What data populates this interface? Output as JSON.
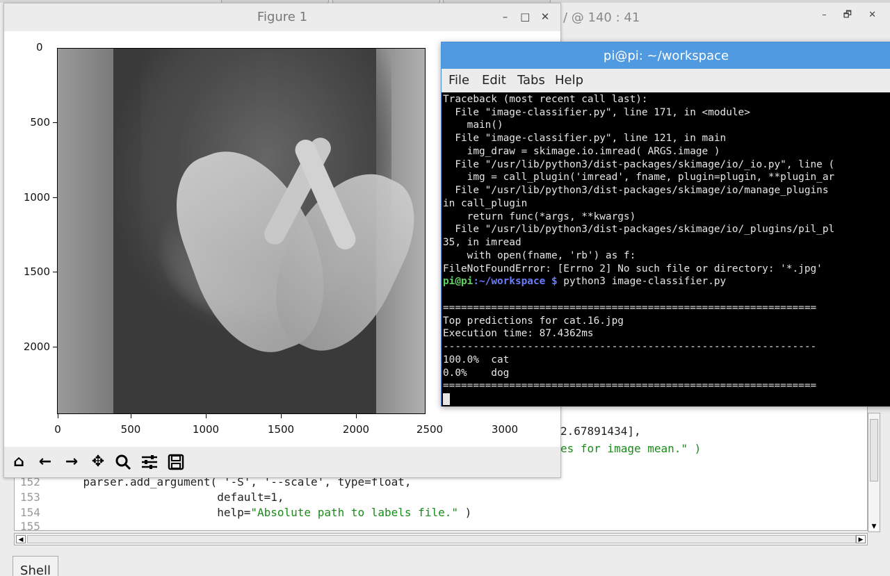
{
  "editor": {
    "title": "/ @ 140 : 41",
    "window_controls": [
      "–",
      "🗗",
      "✕"
    ],
    "partial_lines": [
      {
        "text": "2.67891434],"
      },
      {
        "text": "es for image mean.\" )"
      }
    ],
    "line_numbers": [
      "152",
      "153",
      "154",
      "155"
    ],
    "code_lines": [
      {
        "text": "    parser.add_argument( '-S', '--scale', type=float,"
      },
      {
        "text": "                        default=1,"
      },
      {
        "text": "                        help=",
        "str": "\"Absolute path to labels file.\"",
        "tail": " )"
      }
    ],
    "shell_tab": "Shell"
  },
  "figure": {
    "title": "Figure 1",
    "controls": [
      "–",
      "□",
      "✕"
    ],
    "y_ticks": [
      "500",
      "1000",
      "1500",
      "2000"
    ],
    "x_ticks": [
      "0",
      "500",
      "1000",
      "1500",
      "2000",
      "2500",
      "3000"
    ],
    "top_label": "0",
    "toolbar": [
      "home-icon",
      "back-icon",
      "forward-icon",
      "pan-icon",
      "zoom-icon",
      "configure-icon",
      "save-icon"
    ]
  },
  "terminal": {
    "title": "pi@pi: ~/workspace",
    "menu": [
      "File",
      "Edit",
      "Tabs",
      "Help"
    ],
    "lines": [
      "Traceback (most recent call last):",
      "  File \"image-classifier.py\", line 171, in <module>",
      "    main()",
      "  File \"image-classifier.py\", line 121, in main",
      "    img_draw = skimage.io.imread( ARGS.image )",
      "  File \"/usr/lib/python3/dist-packages/skimage/io/_io.py\", line (",
      "    img = call_plugin('imread', fname, plugin=plugin, **plugin_ar",
      "  File \"/usr/lib/python3/dist-packages/skimage/io/manage_plugins",
      "in call_plugin",
      "    return func(*args, **kwargs)",
      "  File \"/usr/lib/python3/dist-packages/skimage/io/_plugins/pil_pl",
      "35, in imread",
      "    with open(fname, 'rb') as f:",
      "FileNotFoundError: [Errno 2] No such file or directory: '*.jpg'"
    ],
    "prompt_user": "pi@pi",
    "prompt_path": ":~/workspace $",
    "command": " python3 image-classifier.py",
    "output_lines": [
      "",
      "==============================================================",
      "Top predictions for cat.16.jpg",
      "Execution time: 87.4362ms",
      "--------------------------------------------------------------",
      "100.0%  cat",
      "0.0%    dog",
      "=============================================================="
    ]
  }
}
